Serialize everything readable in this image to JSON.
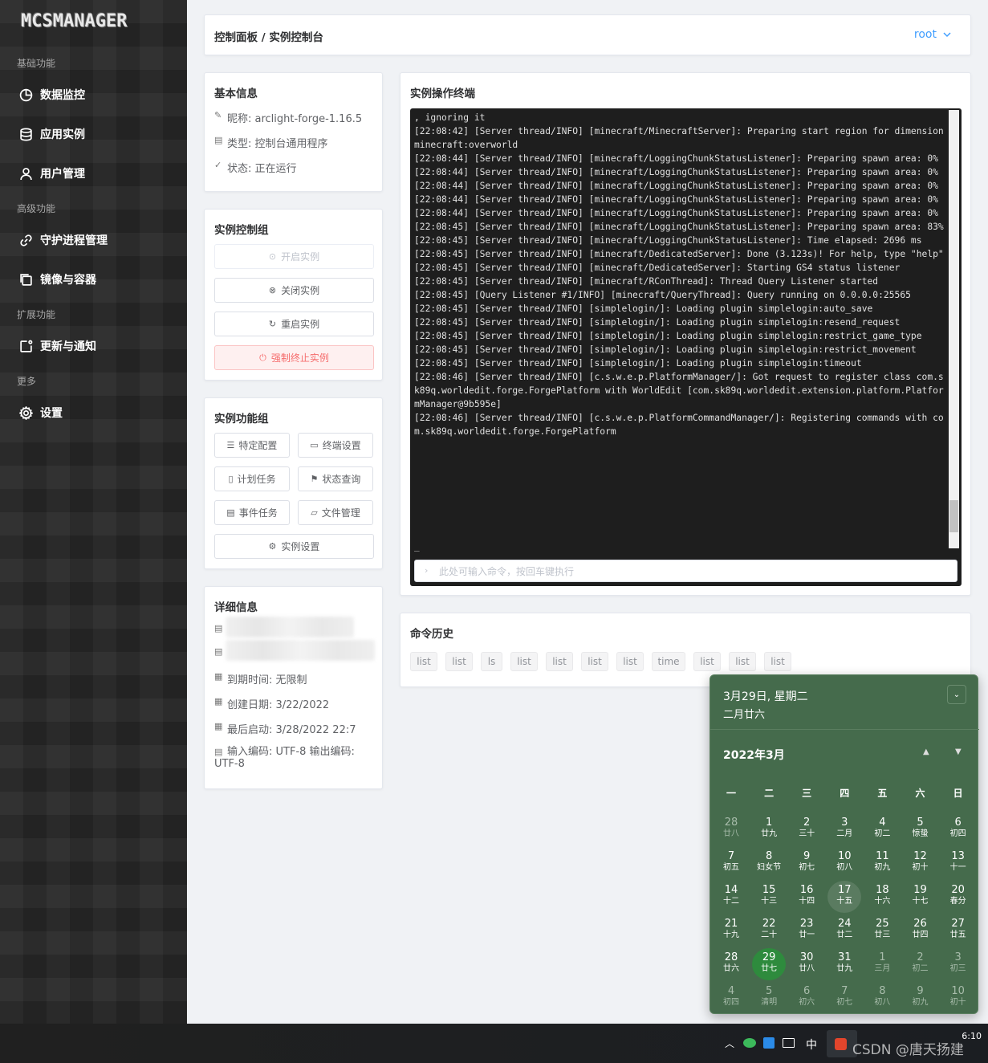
{
  "sidebar": {
    "logo": "MCSMANAGER",
    "groups": [
      "基础功能",
      "高级功能",
      "扩展功能",
      "更多"
    ],
    "items": [
      {
        "label": "数据监控",
        "icon": "dashboard-icon"
      },
      {
        "label": "应用实例",
        "icon": "database-icon"
      },
      {
        "label": "用户管理",
        "icon": "user-icon"
      },
      {
        "label": "守护进程管理",
        "icon": "link-icon"
      },
      {
        "label": "镜像与容器",
        "icon": "copy-icon"
      },
      {
        "label": "更新与通知",
        "icon": "notify-icon"
      },
      {
        "label": "设置",
        "icon": "gear-icon"
      }
    ]
  },
  "header": {
    "breadcrumb": "控制面板 / 实例控制台",
    "user": "root"
  },
  "basic_info": {
    "title": "基本信息",
    "nickname": "昵称: arclight-forge-1.16.5",
    "type": "类型: 控制台通用程序",
    "status": "状态: 正在运行"
  },
  "control_group": {
    "title": "实例控制组",
    "start": "开启实例",
    "stop": "关闭实例",
    "restart": "重启实例",
    "kill": "强制终止实例"
  },
  "function_group": {
    "title": "实例功能组",
    "special_config": "特定配置",
    "terminal_settings": "终端设置",
    "schedule": "计划任务",
    "status_query": "状态查询",
    "event_tasks": "事件任务",
    "file_manager": "文件管理",
    "instance_settings": "实例设置"
  },
  "details": {
    "title": "详细信息",
    "expire": "到期时间: 无限制",
    "created": "创建日期: 3/22/2022",
    "last_start": "最后启动: 3/28/2022 22:7",
    "encoding": "输入编码: UTF-8 输出编码: UTF-8"
  },
  "terminal": {
    "title": "实例操作终端",
    "lines": [
      ", ignoring it",
      "[22:08:42] [Server thread/INFO] [minecraft/MinecraftServer]: Preparing start region for dimension minecraft:overworld",
      "[22:08:44] [Server thread/INFO] [minecraft/LoggingChunkStatusListener]: Preparing spawn area: 0%",
      "[22:08:44] [Server thread/INFO] [minecraft/LoggingChunkStatusListener]: Preparing spawn area: 0%",
      "[22:08:44] [Server thread/INFO] [minecraft/LoggingChunkStatusListener]: Preparing spawn area: 0%",
      "[22:08:44] [Server thread/INFO] [minecraft/LoggingChunkStatusListener]: Preparing spawn area: 0%",
      "[22:08:44] [Server thread/INFO] [minecraft/LoggingChunkStatusListener]: Preparing spawn area: 0%",
      "[22:08:45] [Server thread/INFO] [minecraft/LoggingChunkStatusListener]: Preparing spawn area: 83%",
      "[22:08:45] [Server thread/INFO] [minecraft/LoggingChunkStatusListener]: Time elapsed: 2696 ms",
      "[22:08:45] [Server thread/INFO] [minecraft/DedicatedServer]: Done (3.123s)! For help, type \"help\"",
      "[22:08:45] [Server thread/INFO] [minecraft/DedicatedServer]: Starting GS4 status listener",
      "[22:08:45] [Server thread/INFO] [minecraft/RConThread]: Thread Query Listener started",
      "[22:08:45] [Query Listener #1/INFO] [minecraft/QueryThread]: Query running on 0.0.0.0:25565",
      "[22:08:45] [Server thread/INFO] [simplelogin/]: Loading plugin simplelogin:auto_save",
      "[22:08:45] [Server thread/INFO] [simplelogin/]: Loading plugin simplelogin:resend_request",
      "[22:08:45] [Server thread/INFO] [simplelogin/]: Loading plugin simplelogin:restrict_game_type",
      "[22:08:45] [Server thread/INFO] [simplelogin/]: Loading plugin simplelogin:restrict_movement",
      "[22:08:45] [Server thread/INFO] [simplelogin/]: Loading plugin simplelogin:timeout",
      "[22:08:46] [Server thread/INFO] [c.s.w.e.p.PlatformManager/]: Got request to register class com.sk89q.worldedit.forge.ForgePlatform with WorldEdit [com.sk89q.worldedit.extension.platform.PlatformManager@9b595e]",
      "[22:08:46] [Server thread/INFO] [c.s.w.e.p.PlatformCommandManager/]: Registering commands with com.sk89q.worldedit.forge.ForgePlatform"
    ],
    "cursor": "_",
    "scroll_fraction": 0.96,
    "placeholder": "此处可输入命令，按回车键执行"
  },
  "history": {
    "title": "命令历史",
    "tags": [
      "list",
      "list",
      "ls",
      "list",
      "list",
      "list",
      "list",
      "time",
      "list",
      "list",
      "list"
    ]
  },
  "calendar": {
    "selected_date": "3月29日, 星期二",
    "selected_lunar": "二月廿六",
    "month": "2022年3月",
    "weekdays": [
      "一",
      "二",
      "三",
      "四",
      "五",
      "六",
      "日"
    ],
    "days": [
      [
        "28",
        "廿八"
      ],
      [
        "1",
        "廿九"
      ],
      [
        "2",
        "三十"
      ],
      [
        "3",
        "二月"
      ],
      [
        "4",
        "初二"
      ],
      [
        "5",
        "惊蛰"
      ],
      [
        "6",
        "初四"
      ],
      [
        "7",
        "初五"
      ],
      [
        "8",
        "妇女节"
      ],
      [
        "9",
        "初七"
      ],
      [
        "10",
        "初八"
      ],
      [
        "11",
        "初九"
      ],
      [
        "12",
        "初十"
      ],
      [
        "13",
        "十一"
      ],
      [
        "14",
        "十二"
      ],
      [
        "15",
        "十三"
      ],
      [
        "16",
        "十四"
      ],
      [
        "17",
        "十五"
      ],
      [
        "18",
        "十六"
      ],
      [
        "19",
        "十七"
      ],
      [
        "20",
        "春分"
      ],
      [
        "21",
        "十九"
      ],
      [
        "22",
        "二十"
      ],
      [
        "23",
        "廿一"
      ],
      [
        "24",
        "廿二"
      ],
      [
        "25",
        "廿三"
      ],
      [
        "26",
        "廿四"
      ],
      [
        "27",
        "廿五"
      ],
      [
        "28",
        "廿六"
      ],
      [
        "29",
        "廿七"
      ],
      [
        "30",
        "廿八"
      ],
      [
        "31",
        "廿九"
      ],
      [
        "1",
        "三月"
      ],
      [
        "2",
        "初二"
      ],
      [
        "3",
        "初三"
      ],
      [
        "4",
        "初四"
      ],
      [
        "5",
        "清明"
      ],
      [
        "6",
        "初六"
      ],
      [
        "7",
        "初七"
      ],
      [
        "8",
        "初八"
      ],
      [
        "9",
        "初九"
      ],
      [
        "10",
        "初十"
      ]
    ]
  },
  "taskbar": {
    "ime": "中",
    "time": "6:10",
    "watermark": "CSDN @唐天扬建"
  },
  "colors": {
    "sidebar": "#2b2b2b",
    "accent": "#409eff",
    "danger": "#f56c6c",
    "calendar": "#456b4c",
    "today": "#2e8b3d"
  }
}
